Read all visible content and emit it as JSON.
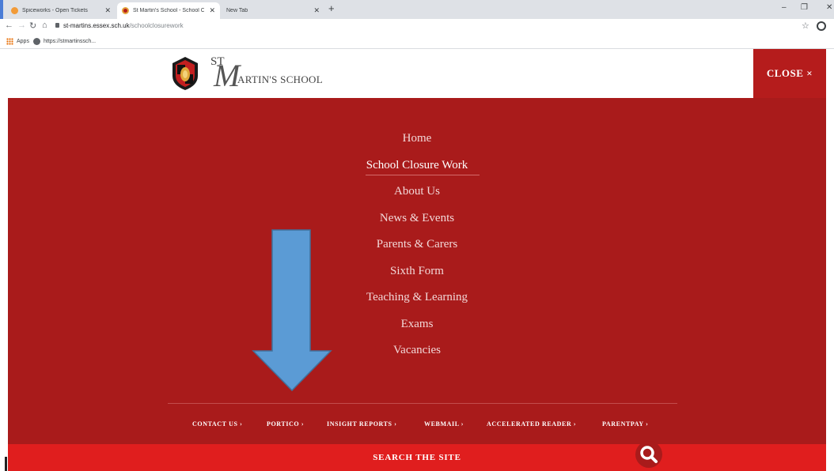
{
  "browser": {
    "tabs": [
      {
        "title": "Spiceworks - Open Tickets",
        "active": false,
        "favicon": "spiceworks-icon"
      },
      {
        "title": "St Martin's School - School Clos...",
        "active": true,
        "favicon": "school-crest-icon"
      },
      {
        "title": "New Tab",
        "active": false,
        "favicon": ""
      }
    ],
    "new_tab_glyph": "+",
    "window_controls": {
      "minimize": "–",
      "restore": "❐",
      "close": "✕"
    },
    "address": {
      "domain": "st-martins.essex.sch.uk",
      "path": "/schoolclosurework"
    },
    "bookmarks": [
      {
        "label": "Apps",
        "icon": "apps-grid-icon"
      },
      {
        "label": "https://stmartinssch...",
        "icon": "globe-icon"
      }
    ]
  },
  "header": {
    "logo": {
      "st": "ST",
      "m": "M",
      "rest": "ARTIN'S SCHOOL"
    },
    "close_label": "CLOSE ×"
  },
  "menu": {
    "items": [
      {
        "label": "Home",
        "active": false
      },
      {
        "label": "School Closure Work",
        "active": true
      },
      {
        "label": "About Us",
        "active": false
      },
      {
        "label": "News & Events",
        "active": false
      },
      {
        "label": "Parents & Carers",
        "active": false
      },
      {
        "label": "Sixth Form",
        "active": false
      },
      {
        "label": "Teaching & Learning",
        "active": false
      },
      {
        "label": "Exams",
        "active": false
      },
      {
        "label": "Vacancies",
        "active": false
      }
    ],
    "footer_links": [
      "CONTACT US ›",
      "PORTICO ›",
      "INSIGHT REPORTS ›",
      "WEBMAIL ›",
      "ACCELERATED READER ›",
      "PARENTPAY ›"
    ]
  },
  "search": {
    "label": "SEARCH THE SITE",
    "icon": "search-icon"
  },
  "annotation": {
    "icon": "down-arrow-icon",
    "color": "#5b9bd5"
  },
  "colors": {
    "menu_bg": "#a91b1b",
    "search_bg": "#e01e1e",
    "close_bg": "#b51c1c"
  }
}
